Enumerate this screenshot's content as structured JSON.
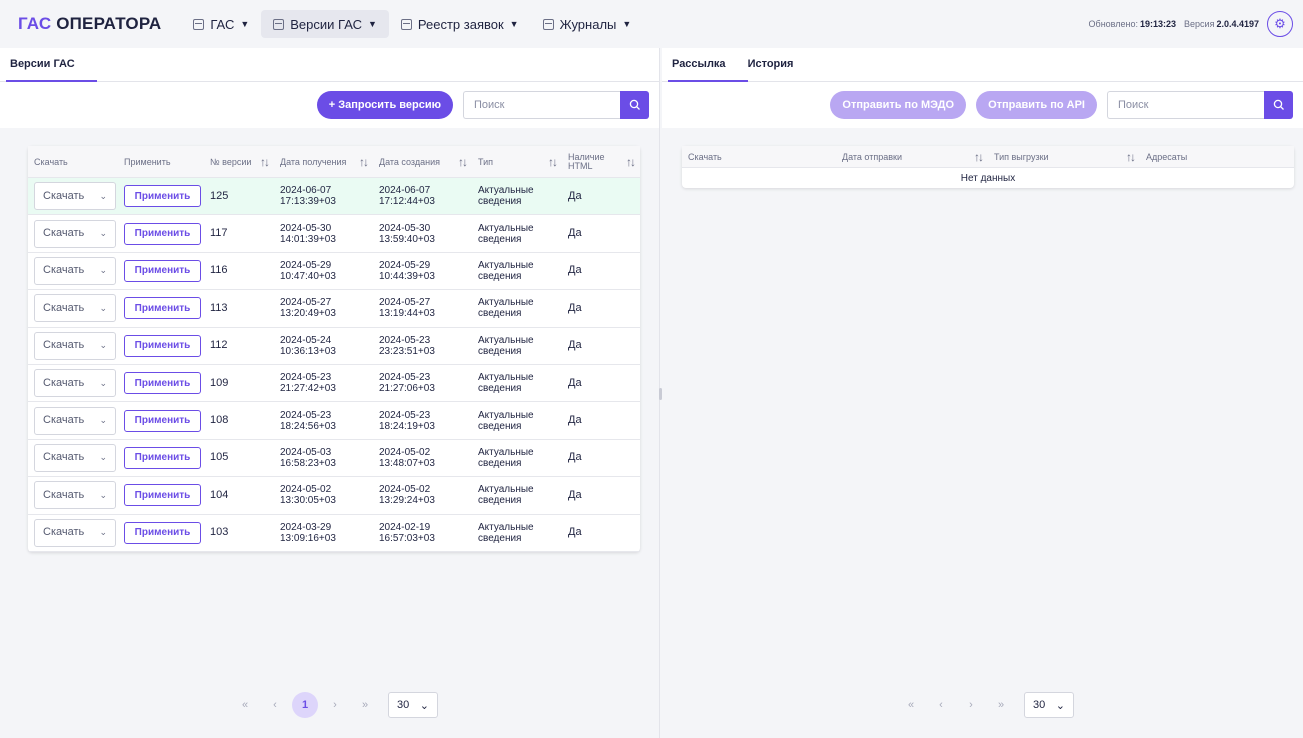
{
  "app": {
    "logo_accent": "ГАС",
    "logo_rest": " ОПЕРАТОРА"
  },
  "nav": [
    {
      "label": "ГАС"
    },
    {
      "label": "Версии ГАС"
    },
    {
      "label": "Реестр заявок"
    },
    {
      "label": "Журналы"
    }
  ],
  "status": {
    "updated_label": "Обновлено:",
    "updated_time": "19:13:23",
    "version_label": "Версия",
    "version_value": "2.0.4.4197"
  },
  "left": {
    "tab": "Версии ГАС",
    "request_button": "+ Запросить версию",
    "search_placeholder": "Поиск",
    "columns": [
      "Скачать",
      "Применить",
      "№ версии",
      "Дата получения",
      "Дата создания",
      "Тип",
      "Наличие HTML"
    ],
    "rows": [
      {
        "download": "Скачать",
        "apply": "Применить",
        "num": "125",
        "recv_date": "2024-06-07",
        "recv_time": "17:13:39+03",
        "create_date": "2024-06-07",
        "create_time": "17:12:44+03",
        "type1": "Актуальные",
        "type2": "сведения",
        "html": "Да"
      },
      {
        "download": "Скачать",
        "apply": "Применить",
        "num": "117",
        "recv_date": "2024-05-30",
        "recv_time": "14:01:39+03",
        "create_date": "2024-05-30",
        "create_time": "13:59:40+03",
        "type1": "Актуальные",
        "type2": "сведения",
        "html": "Да"
      },
      {
        "download": "Скачать",
        "apply": "Применить",
        "num": "116",
        "recv_date": "2024-05-29",
        "recv_time": "10:47:40+03",
        "create_date": "2024-05-29",
        "create_time": "10:44:39+03",
        "type1": "Актуальные",
        "type2": "сведения",
        "html": "Да"
      },
      {
        "download": "Скачать",
        "apply": "Применить",
        "num": "113",
        "recv_date": "2024-05-27",
        "recv_time": "13:20:49+03",
        "create_date": "2024-05-27",
        "create_time": "13:19:44+03",
        "type1": "Актуальные",
        "type2": "сведения",
        "html": "Да"
      },
      {
        "download": "Скачать",
        "apply": "Применить",
        "num": "112",
        "recv_date": "2024-05-24",
        "recv_time": "10:36:13+03",
        "create_date": "2024-05-23",
        "create_time": "23:23:51+03",
        "type1": "Актуальные",
        "type2": "сведения",
        "html": "Да"
      },
      {
        "download": "Скачать",
        "apply": "Применить",
        "num": "109",
        "recv_date": "2024-05-23",
        "recv_time": "21:27:42+03",
        "create_date": "2024-05-23",
        "create_time": "21:27:06+03",
        "type1": "Актуальные",
        "type2": "сведения",
        "html": "Да"
      },
      {
        "download": "Скачать",
        "apply": "Применить",
        "num": "108",
        "recv_date": "2024-05-23",
        "recv_time": "18:24:56+03",
        "create_date": "2024-05-23",
        "create_time": "18:24:19+03",
        "type1": "Актуальные",
        "type2": "сведения",
        "html": "Да"
      },
      {
        "download": "Скачать",
        "apply": "Применить",
        "num": "105",
        "recv_date": "2024-05-03",
        "recv_time": "16:58:23+03",
        "create_date": "2024-05-02",
        "create_time": "13:48:07+03",
        "type1": "Актуальные",
        "type2": "сведения",
        "html": "Да"
      },
      {
        "download": "Скачать",
        "apply": "Применить",
        "num": "104",
        "recv_date": "2024-05-02",
        "recv_time": "13:30:05+03",
        "create_date": "2024-05-02",
        "create_time": "13:29:24+03",
        "type1": "Актуальные",
        "type2": "сведения",
        "html": "Да"
      },
      {
        "download": "Скачать",
        "apply": "Применить",
        "num": "103",
        "recv_date": "2024-03-29",
        "recv_time": "13:09:16+03",
        "create_date": "2024-02-19",
        "create_time": "16:57:03+03",
        "type1": "Актуальные",
        "type2": "сведения",
        "html": "Да"
      }
    ],
    "pager": {
      "current": "1",
      "page_size": "30"
    }
  },
  "right": {
    "tabs": [
      "Рассылка",
      "История"
    ],
    "send_mzdo": "Отправить по МЭДО",
    "send_api": "Отправить по API",
    "search_placeholder": "Поиск",
    "columns": [
      "Скачать",
      "Дата отправки",
      "Тип выгрузки",
      "Адресаты"
    ],
    "empty": "Нет данных",
    "pager": {
      "page_size": "30"
    }
  },
  "colors": {
    "accent": "#6b4de6",
    "highlight_row": "#eafbf3"
  }
}
